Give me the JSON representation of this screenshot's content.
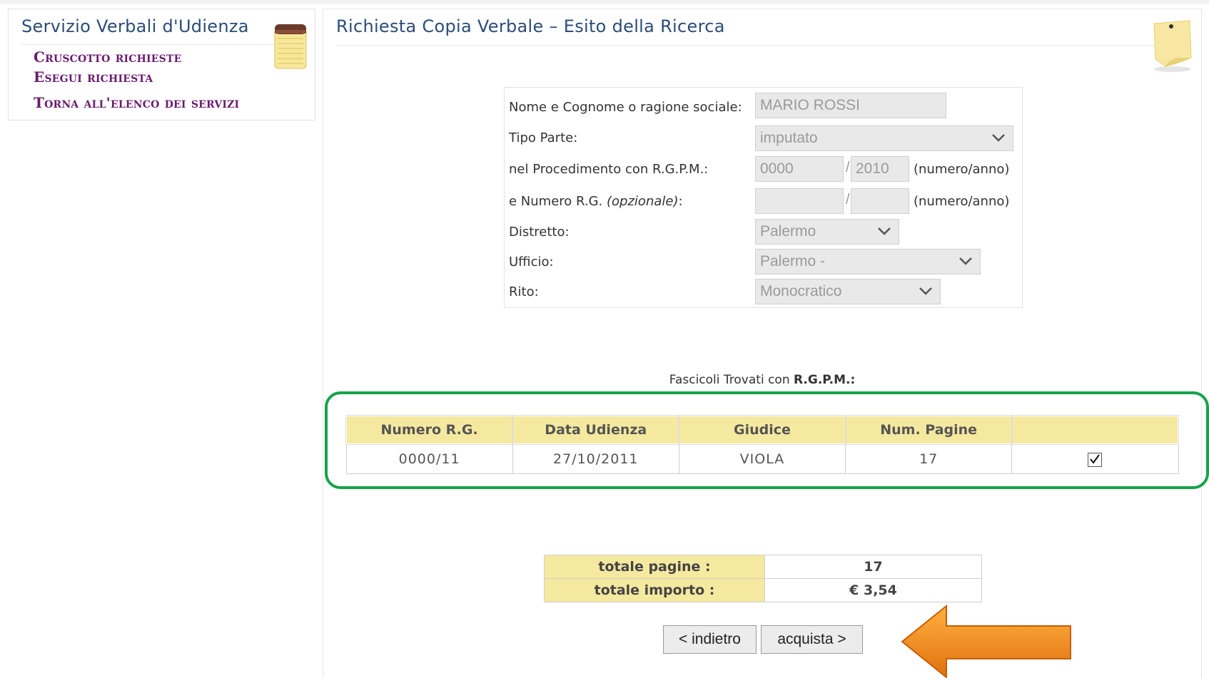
{
  "sidebar": {
    "title": "Servizio Verbali d'Udienza",
    "links": [
      "Cruscotto richieste",
      "Esegui richiesta",
      "Torna all'elenco dei servizi"
    ]
  },
  "main": {
    "title": "Richiesta Copia Verbale – Esito della Ricerca"
  },
  "form": {
    "name_label": "Nome e Cognome o ragione sociale:",
    "name_value": "MARIO ROSSI",
    "tipo_label": "Tipo Parte:",
    "tipo_value": "imputato",
    "rgpm_label": "nel Procedimento con R.G.P.M.:",
    "rgpm_num": "0000",
    "rgpm_year": "2010",
    "rg_label_main": "e Numero R.G.",
    "rg_label_opt": "(opzionale)",
    "rg_label_end": ":",
    "rg_num": "",
    "rg_year": "",
    "hint": "(numero/anno)",
    "slash": "/",
    "distretto_label": "Distretto:",
    "distretto_value": "Palermo",
    "ufficio_label": "Ufficio:",
    "ufficio_value": "Palermo -",
    "rito_label": "Rito:",
    "rito_value": "Monocratico"
  },
  "results": {
    "caption_prefix": "Fascicoli Trovati con",
    "caption_bold": "R.G.P.M.:",
    "headers": [
      "Numero R.G.",
      "Data Udienza",
      "Giudice",
      "Num. Pagine",
      ""
    ],
    "rows": [
      {
        "numero": "0000/11",
        "data": "27/10/2011",
        "giudice": "VIOLA",
        "pagine": "17",
        "selected": true
      }
    ]
  },
  "totals": {
    "pagine_label": "totale pagine :",
    "pagine_value": "17",
    "importo_label": "totale importo :",
    "importo_value": "€ 3,54"
  },
  "buttons": {
    "back": "< indietro",
    "buy": "acquista >"
  },
  "colors": {
    "highlight_outline": "#16a34a",
    "arrow": "#f08a1c",
    "header_bg": "#f5e9a0"
  }
}
